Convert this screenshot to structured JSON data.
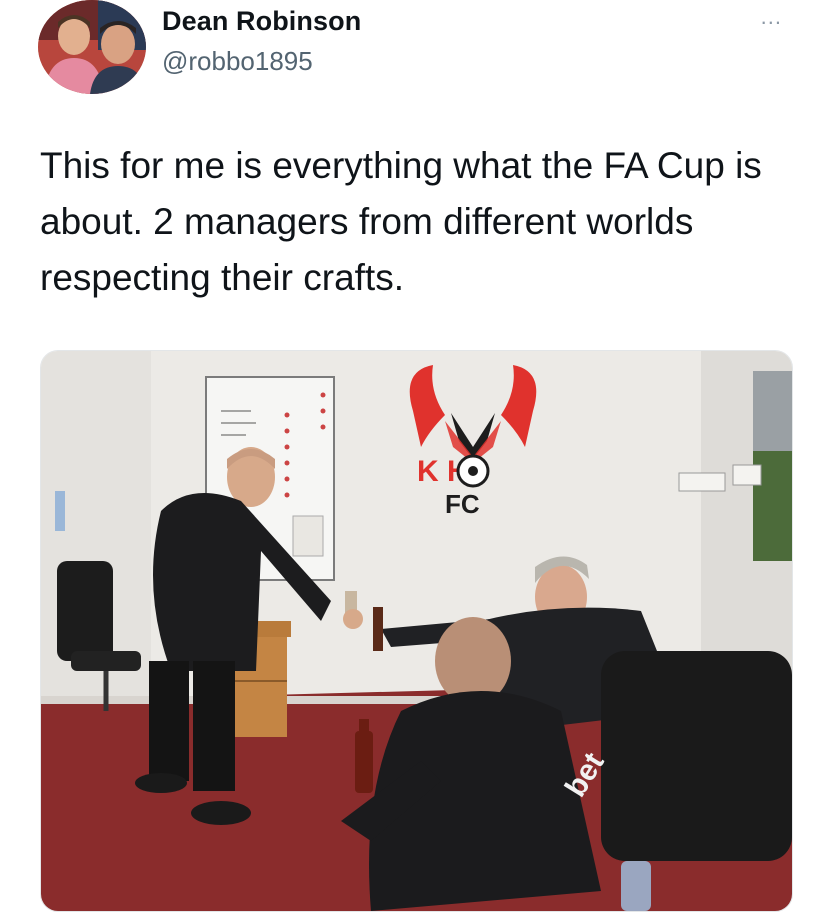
{
  "tweet": {
    "author_name": "Dean Robinson",
    "author_handle": "@robbo1895",
    "more_label": "...",
    "text": "This for me is everything what the FA Cup is about. 2 managers from different worlds respecting their crafts."
  },
  "media": {
    "alt": "Two football managers toasting with bottles in a changing room",
    "crest_text_top": "K H",
    "crest_text_bottom": "FC",
    "jacket_text": "bet"
  },
  "colors": {
    "text": "#0f1419",
    "secondary": "#536471",
    "crest_red": "#e0322d",
    "carpet": "#8a2c2c"
  }
}
